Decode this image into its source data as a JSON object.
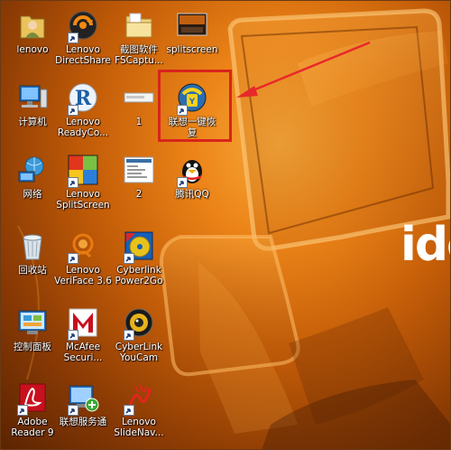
{
  "desktop": {
    "brand_text": "ide",
    "icons": [
      {
        "id": "lenovo",
        "label": "lenovo",
        "icon": "user-folder-icon",
        "shortcut": false
      },
      {
        "id": "lenovo-directshare",
        "label": "Lenovo\nDirectShare",
        "icon": "directshare-icon",
        "shortcut": true
      },
      {
        "id": "fscapture",
        "label": "截图软件\nFSCaptu...",
        "icon": "folder-icon",
        "shortcut": false
      },
      {
        "id": "splitscreen-folder",
        "label": "splitscreen",
        "icon": "splitscreen-thumbnail-icon",
        "shortcut": false
      },
      {
        "id": "computer",
        "label": "计算机",
        "icon": "computer-icon",
        "shortcut": false
      },
      {
        "id": "lenovo-readycomms",
        "label": "Lenovo\nReadyCo...",
        "icon": "readycomm-icon",
        "shortcut": true
      },
      {
        "id": "file-1",
        "label": "1",
        "icon": "document-thumbnail-icon",
        "shortcut": false
      },
      {
        "id": "onekey-recovery",
        "label": "联想一键恢\n复",
        "icon": "onekey-recovery-icon",
        "shortcut": true
      },
      {
        "id": "network",
        "label": "网络",
        "icon": "network-globe-icon",
        "shortcut": false
      },
      {
        "id": "lenovo-splitscreen",
        "label": "Lenovo\nSplitScreen",
        "icon": "split-windows-icon",
        "shortcut": true
      },
      {
        "id": "file-2",
        "label": "2",
        "icon": "screenshot-thumbnail-icon",
        "shortcut": false
      },
      {
        "id": "tencent-qq",
        "label": "腾讯QQ",
        "icon": "qq-penguin-icon",
        "shortcut": true
      },
      {
        "id": "recycle-bin",
        "label": "回收站",
        "icon": "recycle-bin-icon",
        "shortcut": false
      },
      {
        "id": "lenovo-veriface",
        "label": "Lenovo\nVeriFace 3.6",
        "icon": "veriface-icon",
        "shortcut": true
      },
      {
        "id": "cyberlink-power2go",
        "label": "Cyberlink\nPower2Go",
        "icon": "power2go-icon",
        "shortcut": true
      },
      {
        "id": "control-panel",
        "label": "控制面板",
        "icon": "control-panel-icon",
        "shortcut": false
      },
      {
        "id": "mcafee",
        "label": "McAfee\nSecuri...",
        "icon": "mcafee-icon",
        "shortcut": true
      },
      {
        "id": "cyberlink-youcam",
        "label": "CyberLink\nYouCam",
        "icon": "youcam-icon",
        "shortcut": true
      },
      {
        "id": "adobe-reader",
        "label": "Adobe\nReader 9",
        "icon": "adobe-reader-icon",
        "shortcut": true
      },
      {
        "id": "lenovo-service",
        "label": "联想服务通",
        "icon": "service-monitor-icon",
        "shortcut": true
      },
      {
        "id": "lenovo-slidenav",
        "label": "Lenovo\nSlideNav...",
        "icon": "slidenav-icon",
        "shortcut": true
      }
    ]
  },
  "annotation": {
    "highlight_color": "#d8241c",
    "arrow_color": "#e8282a"
  }
}
